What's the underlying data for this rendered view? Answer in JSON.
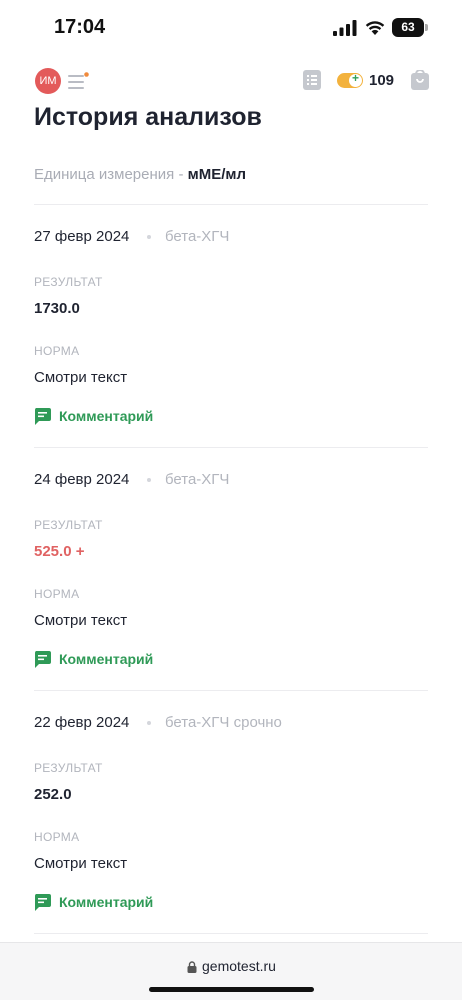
{
  "status_bar": {
    "time": "17:04",
    "battery": "63"
  },
  "header": {
    "avatar_initials": "ИМ",
    "bonus_count": "109"
  },
  "page": {
    "title": "История анализов",
    "unit_label": "Единица измерения - ",
    "unit_value": "мМЕ/мл"
  },
  "labels": {
    "result": "РЕЗУЛЬТАТ",
    "norm": "НОРМА",
    "comment": "Комментарий"
  },
  "entries": [
    {
      "date": "27 февр 2024",
      "test": "бета-ХГЧ",
      "result": "1730.0",
      "norm": "Смотри текст"
    },
    {
      "date": "24 февр 2024",
      "test": "бета-ХГЧ",
      "result": "525.0 +",
      "norm": "Смотри текст"
    },
    {
      "date": "22 февр 2024",
      "test": "бета-ХГЧ срочно",
      "result": "252.0",
      "norm": "Смотри текст"
    }
  ],
  "browser": {
    "url": "gemotest.ru"
  },
  "colors": {
    "accent_green": "#2f9a57",
    "alert_red": "#e06262",
    "avatar_red": "#e35a5a",
    "bonus_orange": "#f3b23d"
  }
}
